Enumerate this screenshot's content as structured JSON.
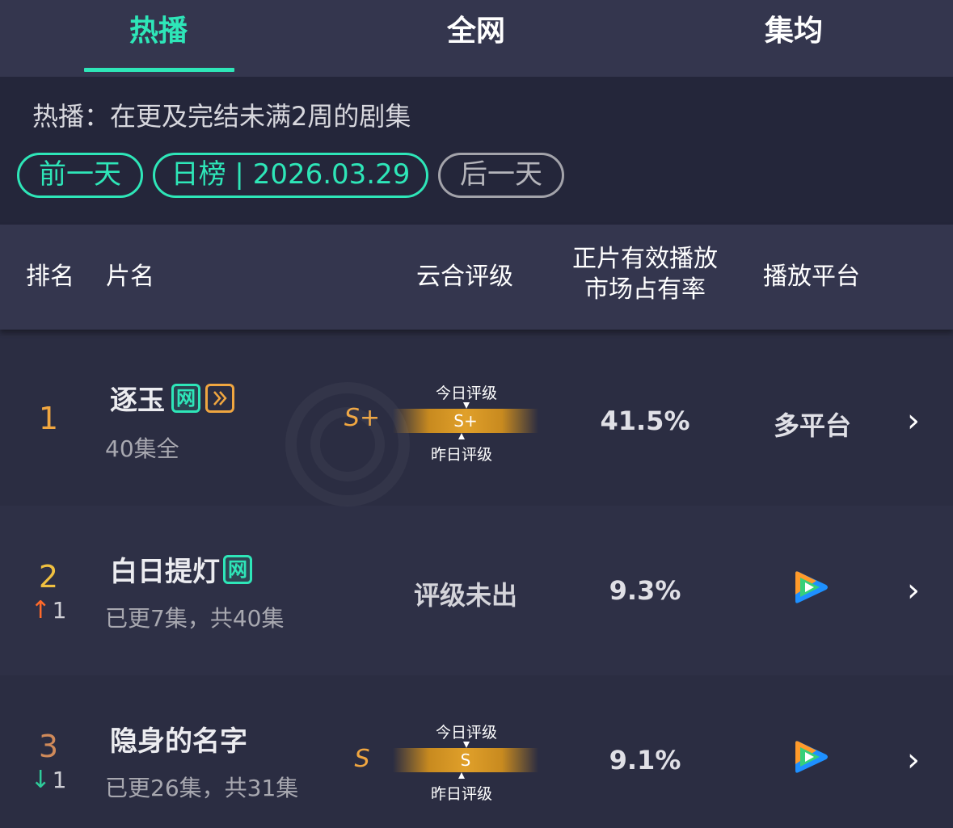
{
  "tabs": [
    {
      "label": "热播",
      "active": true
    },
    {
      "label": "全网",
      "active": false
    },
    {
      "label": "集均",
      "active": false
    }
  ],
  "filter": {
    "description": "热播：在更及完结未满2周的剧集",
    "prev_day": "前一天",
    "current": "日榜 | 2026.03.29",
    "next_day": "后一天"
  },
  "table_header": {
    "rank": "排名",
    "title": "片名",
    "rating": "云合评级",
    "share_line1": "正片有效播放",
    "share_line2": "市场占有率",
    "platform": "播放平台"
  },
  "rows": [
    {
      "rank": "1",
      "title": "逐玉",
      "tags": [
        "网",
        "play"
      ],
      "episodes": "40集全",
      "grade": "S+",
      "grade_bar": "S+",
      "today_label": "今日评级",
      "yesterday_label": "昨日评级",
      "share": "41.5%",
      "platform": "多平台"
    },
    {
      "rank": "2",
      "change": "1",
      "change_dir": "up",
      "title": "白日提灯",
      "tags": [
        "网"
      ],
      "episodes": "已更7集，共40集",
      "grade_status": "评级未出",
      "share": "9.3%",
      "platform_icon": "tencent-video-icon"
    },
    {
      "rank": "3",
      "change": "1",
      "change_dir": "down",
      "title": "隐身的名字",
      "episodes": "已更26集，共31集",
      "grade": "S",
      "grade_bar": "S",
      "today_label": "今日评级",
      "yesterday_label": "昨日评级",
      "share": "9.1%",
      "platform_icon": "tencent-video-icon"
    }
  ],
  "colors": {
    "accent": "#2ee6b8",
    "grade": "#f0a640",
    "up": "#ff6a2a",
    "down": "#2ecc9a"
  },
  "watermark_icon": "yunhe-data-watermark"
}
